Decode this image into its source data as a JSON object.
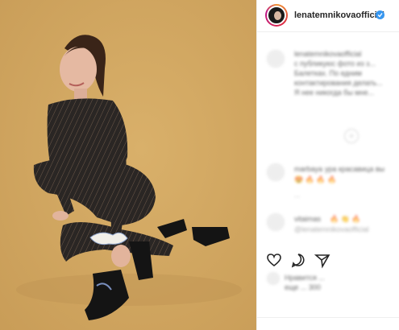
{
  "post": {
    "photo_alt": "photo"
  },
  "header": {
    "username": "lenatemnikovaofficial",
    "avatar_icon": "avatar-icon",
    "verified_icon": "verified-badge-icon",
    "verified_color": "#3897f0"
  },
  "caption": {
    "username": "lenatemnikovaofficial",
    "line1": "с публикуюс фото из з...",
    "line2": "Балетках. По едним",
    "line3": "контактирования делать...",
    "line4": "Я нее никогда бы мне..."
  },
  "comments": [
    {
      "username": "marbaya",
      "text": "ура красавица вы",
      "meta": "...",
      "emoji": "😍 🔥 🔥 🔥"
    },
    {
      "username": "vitaimas",
      "text": "🔥 👏 🔥",
      "meta": "@lenatemnikovaofficial"
    }
  ],
  "actions": {
    "like_icon": "heart-icon",
    "comment_icon": "comment-icon",
    "share_icon": "share-icon",
    "likes_text": "Нравится ...",
    "likes_line2": "еще ... 300"
  },
  "colors": {
    "background": "#d0a660",
    "accent": "#3897f0",
    "border": "#efefef"
  }
}
